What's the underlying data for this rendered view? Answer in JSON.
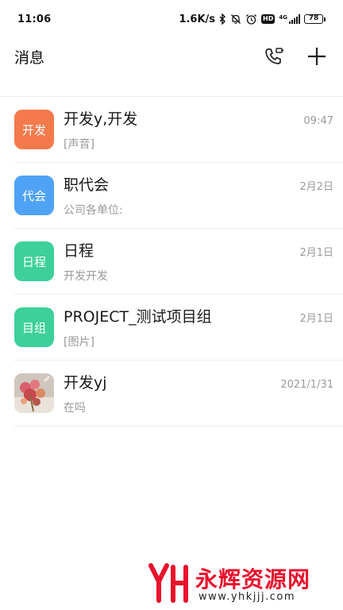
{
  "status_bar": {
    "time": "11:06",
    "net_speed": "1.6K/s",
    "network_label": "4G",
    "hd_label": "HD",
    "battery": "78",
    "icons": [
      "bluetooth-icon",
      "mute-bell-icon",
      "alarm-icon",
      "hd-icon",
      "signal-icon",
      "battery-icon"
    ]
  },
  "header": {
    "title": "消息",
    "actions": [
      "phone-call-icon",
      "plus-icon"
    ]
  },
  "conversations": [
    {
      "avatar_label": "开发",
      "avatar_color": "#F47A4C",
      "name": "开发y,开发",
      "time": "09:47",
      "preview": "[声音]"
    },
    {
      "avatar_label": "代会",
      "avatar_color": "#4FA3F6",
      "name": "职代会",
      "time": "2月2日",
      "preview": "公司各单位:"
    },
    {
      "avatar_label": "日程",
      "avatar_color": "#3DD09A",
      "name": "日程",
      "time": "2月1日",
      "preview": "开发开发"
    },
    {
      "avatar_label": "目组",
      "avatar_color": "#3DD09A",
      "name": "PROJECT_测试项目组",
      "time": "2月1日",
      "preview": "[图片]"
    },
    {
      "avatar_label": "",
      "avatar_color": "",
      "avatar_image": "flower-photo",
      "name": "开发yj",
      "time": "2021/1/31",
      "preview": "在吗"
    }
  ],
  "watermark": {
    "brand": "永辉资源网",
    "url": "www.yhkjjj.com",
    "brand_color": "#E8112D"
  }
}
